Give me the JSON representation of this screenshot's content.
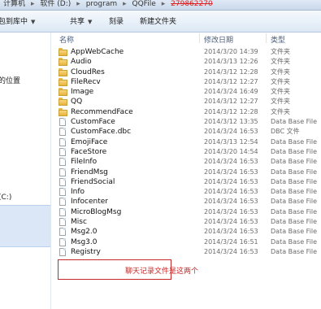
{
  "breadcrumb": {
    "items": [
      "计算机",
      "软件 (D:)",
      "program",
      "QQFile",
      "279862270"
    ]
  },
  "toolbar": {
    "include_label": "包到库中",
    "share_label": "共享",
    "burn_label": "刻录",
    "new_folder_label": "新建文件夹"
  },
  "sidebar": {
    "items": [
      {
        "label": "的位置"
      },
      {
        "label": "(C:)"
      }
    ]
  },
  "columns": {
    "name": "名称",
    "date": "修改日期",
    "type": "类型"
  },
  "files": [
    {
      "name": "AppWebCache",
      "date": "2014/3/20 14:39",
      "type": "文件夹",
      "icon": "folder-icon"
    },
    {
      "name": "Audio",
      "date": "2014/3/13 12:26",
      "type": "文件夹",
      "icon": "folder-icon"
    },
    {
      "name": "CloudRes",
      "date": "2014/3/12 12:28",
      "type": "文件夹",
      "icon": "folder-icon"
    },
    {
      "name": "FileRecv",
      "date": "2014/3/12 12:27",
      "type": "文件夹",
      "icon": "folder-icon"
    },
    {
      "name": "Image",
      "date": "2014/3/24 16:49",
      "type": "文件夹",
      "icon": "folder-icon"
    },
    {
      "name": "QQ",
      "date": "2014/3/12 12:27",
      "type": "文件夹",
      "icon": "folder-icon"
    },
    {
      "name": "RecommendFace",
      "date": "2014/3/12 12:28",
      "type": "文件夹",
      "icon": "folder-icon"
    },
    {
      "name": "CustomFace",
      "date": "2014/3/12 13:35",
      "type": "Data Base File",
      "icon": "file-icon"
    },
    {
      "name": "CustomFace.dbc",
      "date": "2014/3/24 16:53",
      "type": "DBC 文件",
      "icon": "file-icon"
    },
    {
      "name": "EmojiFace",
      "date": "2014/3/13 12:54",
      "type": "Data Base File",
      "icon": "file-icon"
    },
    {
      "name": "FaceStore",
      "date": "2014/3/20 14:54",
      "type": "Data Base File",
      "icon": "file-icon"
    },
    {
      "name": "FileInfo",
      "date": "2014/3/24 16:53",
      "type": "Data Base File",
      "icon": "file-icon"
    },
    {
      "name": "FriendMsg",
      "date": "2014/3/24 16:53",
      "type": "Data Base File",
      "icon": "file-icon"
    },
    {
      "name": "FriendSocial",
      "date": "2014/3/24 16:53",
      "type": "Data Base File",
      "icon": "file-icon"
    },
    {
      "name": "Info",
      "date": "2014/3/24 16:53",
      "type": "Data Base File",
      "icon": "file-icon"
    },
    {
      "name": "Infocenter",
      "date": "2014/3/24 16:53",
      "type": "Data Base File",
      "icon": "file-icon"
    },
    {
      "name": "MicroBlogMsg",
      "date": "2014/3/24 16:53",
      "type": "Data Base File",
      "icon": "file-icon"
    },
    {
      "name": "Misc",
      "date": "2014/3/24 16:53",
      "type": "Data Base File",
      "icon": "file-icon"
    },
    {
      "name": "Msg2.0",
      "date": "2014/3/24 16:53",
      "type": "Data Base File",
      "icon": "file-icon"
    },
    {
      "name": "Msg3.0",
      "date": "2014/3/24 16:51",
      "type": "Data Base File",
      "icon": "file-icon"
    },
    {
      "name": "Registry",
      "date": "2014/3/24 16:53",
      "type": "Data Base File",
      "icon": "file-icon"
    }
  ],
  "annotation": {
    "text": "聊天记录文件是这两个",
    "color": "#c62828"
  },
  "colors": {
    "folder": "#f0c55a",
    "toolbar_bg": "#e4edf8",
    "header_text": "#4a5e7a",
    "secondary_text": "#6b6b6b"
  }
}
